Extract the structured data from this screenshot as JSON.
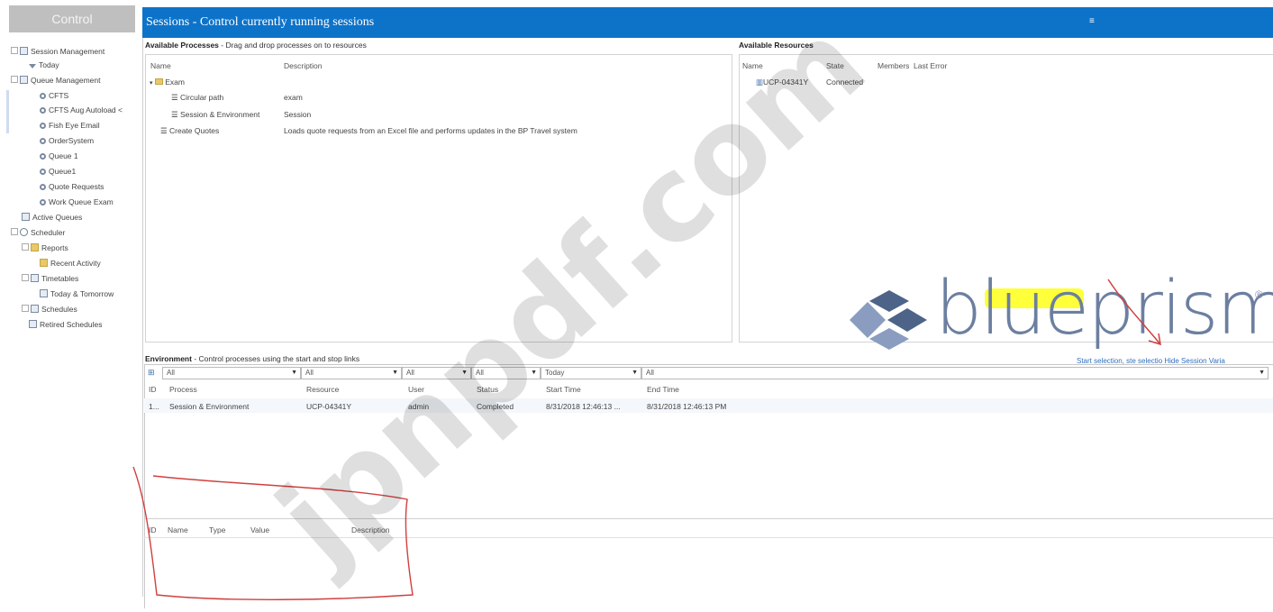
{
  "nav": {
    "header": "Control",
    "items": [
      {
        "label": "Session Management",
        "icon": "grid-icon"
      },
      {
        "label": "Today",
        "icon": "filter-icon"
      },
      {
        "label": "Queue Management",
        "icon": "grid-icon"
      },
      {
        "label": "CFTS",
        "icon": "gear-icon"
      },
      {
        "label": "CFTS Aug Autoload <",
        "icon": "gear-icon"
      },
      {
        "label": "Fish Eye Email",
        "icon": "gear-icon"
      },
      {
        "label": "OrderSystem",
        "icon": "gear-icon"
      },
      {
        "label": "Queue 1",
        "icon": "gear-icon"
      },
      {
        "label": "Queue1",
        "icon": "gear-icon"
      },
      {
        "label": "Quote Requests",
        "icon": "gear-icon"
      },
      {
        "label": "Work Queue Exam",
        "icon": "gear-icon"
      },
      {
        "label": "Active Queues",
        "icon": "grid-icon"
      },
      {
        "label": "Scheduler",
        "icon": "clock-icon"
      },
      {
        "label": "Reports",
        "icon": "folder-icon"
      },
      {
        "label": "Recent Activity",
        "icon": "folder-icon"
      },
      {
        "label": "Timetables",
        "icon": "grid-icon"
      },
      {
        "label": "Today & Tomorrow",
        "icon": "grid-icon"
      },
      {
        "label": "Schedules",
        "icon": "grid-icon"
      },
      {
        "label": "Retired Schedules",
        "icon": "grid-icon"
      }
    ]
  },
  "title_bar": {
    "title": "Sessions - Control currently running sessions",
    "menu_icon": "hamburger-icon"
  },
  "processes": {
    "heading": "Available Processes",
    "hint": " - Drag and drop processes on to resources",
    "columns": [
      "Name",
      "Description"
    ],
    "rows": [
      {
        "name": "Exam",
        "description": ""
      },
      {
        "name": "Circular path",
        "description": "exam"
      },
      {
        "name": "Session & Environment",
        "description": "Session"
      },
      {
        "name": "Create Quotes",
        "description": "Loads quote requests from an Excel file and performs updates in the BP Travel system"
      }
    ]
  },
  "resources": {
    "heading": "Available Resources",
    "columns": [
      "Name",
      "State",
      "Members",
      "Last Error"
    ],
    "rows": [
      {
        "name": "UCP-04341Y",
        "state": "Connected"
      }
    ]
  },
  "logo": {
    "word": "blueprism",
    "reg": "®",
    "colors": {
      "light": "#8a9dc0",
      "dark": "#4e6388"
    }
  },
  "environment": {
    "heading": "Environment",
    "hint": " - Control processes using the start and stop links",
    "filters": [
      "All",
      "All",
      "All",
      "All",
      "Today",
      "All"
    ],
    "links": "Start selection, ste selectio Hide Session Varia",
    "columns": [
      "ID",
      "Process",
      "Resource",
      "User",
      "Status",
      "Start Time",
      "End Time"
    ],
    "rows": [
      {
        "id": "1...",
        "process": "Session & Environment",
        "resource": "UCP-04341Y",
        "user": "admin",
        "status": "Completed",
        "start": "8/31/2018 12:46:13 ...",
        "end": "8/31/2018 12:46:13 PM"
      }
    ]
  },
  "variables": {
    "columns": [
      "ID",
      "Name",
      "Type",
      "Value",
      "Description"
    ]
  },
  "watermark": "jpnpdf.com",
  "colors": {
    "title_bar": "#0d73c9",
    "annotation": "#d0403f",
    "highlight": "#ffff25"
  }
}
